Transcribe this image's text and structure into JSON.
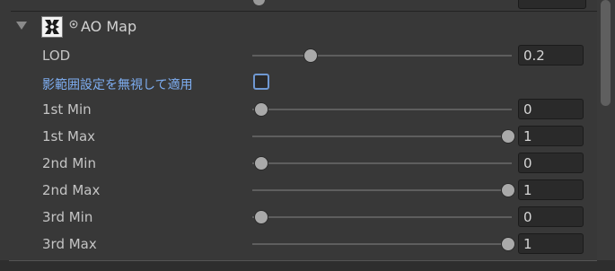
{
  "section": {
    "title": "AO Map",
    "expanded": true,
    "icons": {
      "foldout": "triangle-down-icon",
      "thumbnail": "texture-thumbnail-icon",
      "target": "object-picker-icon"
    }
  },
  "rows": [
    {
      "id": "lod",
      "label": "LOD",
      "value": "0.2",
      "slider_fraction": 0.2
    },
    {
      "id": "ignore-range",
      "label": "影範囲設定を無視して適用",
      "checkbox": true,
      "checked": false
    },
    {
      "id": "1st-min",
      "label": "1st Min",
      "value": "0",
      "slider_fraction": 0
    },
    {
      "id": "1st-max",
      "label": "1st Max",
      "value": "1",
      "slider_fraction": 1
    },
    {
      "id": "2nd-min",
      "label": "2nd Min",
      "value": "0",
      "slider_fraction": 0
    },
    {
      "id": "2nd-max",
      "label": "2nd Max",
      "value": "1",
      "slider_fraction": 1
    },
    {
      "id": "3rd-min",
      "label": "3rd Min",
      "value": "0",
      "slider_fraction": 0
    },
    {
      "id": "3rd-max",
      "label": "3rd Max",
      "value": "1",
      "slider_fraction": 1
    }
  ],
  "colors": {
    "background": "#383838",
    "field": "#2a2a2a",
    "label": "#c4c4c4",
    "highlight_label": "#7eaef2",
    "checkbox_border": "#6f98d2",
    "slider_knob": "#a9a9a9"
  }
}
